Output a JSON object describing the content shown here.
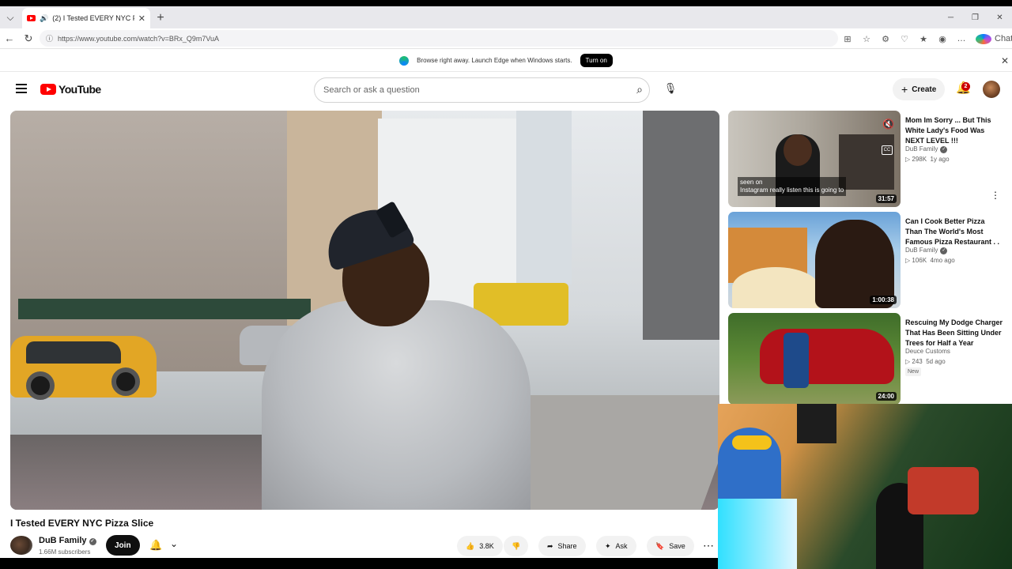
{
  "browser": {
    "tab_title": "(2) I Tested EVERY NYC Pizza Slice",
    "url": "https://www.youtube.com/watch?v=BRx_Q9m7VuA",
    "copilot_label": "Chat"
  },
  "infobar": {
    "message": "Browse right away. Launch Edge when Windows starts.",
    "button": "Turn on"
  },
  "header": {
    "logo_text": "YouTube",
    "search_placeholder": "Search or ask a question",
    "create_label": "Create",
    "notif_count": "2"
  },
  "video": {
    "title": "I Tested EVERY NYC Pizza Slice",
    "channel": "DuB Family",
    "subscribers": "1.66M subscribers",
    "join_label": "Join",
    "like_count": "3.8K",
    "share_label": "Share",
    "ask_label": "Ask",
    "save_label": "Save"
  },
  "recommended": [
    {
      "title": "Mom Im Sorry ... But This White Lady's Food Was NEXT LEVEL !!!",
      "channel": "DuB Family",
      "views": "298K",
      "age": "1y ago",
      "duration": "31:57",
      "caption": "seen on\nInstagram really listen this is going to",
      "cc": "CC"
    },
    {
      "title": "Can I Cook Better Pizza Than The World's Most Famous Pizza Restaurant . .",
      "channel": "DuB Family",
      "views": "106K",
      "age": "4mo ago",
      "duration": "1:00:38"
    },
    {
      "title": "Rescuing My Dodge Charger That Has Been Sitting Under Trees for Half a Year",
      "channel": "Deuce Customs",
      "views": "243",
      "age": "5d ago",
      "duration": "24:00",
      "badge": "New"
    }
  ]
}
